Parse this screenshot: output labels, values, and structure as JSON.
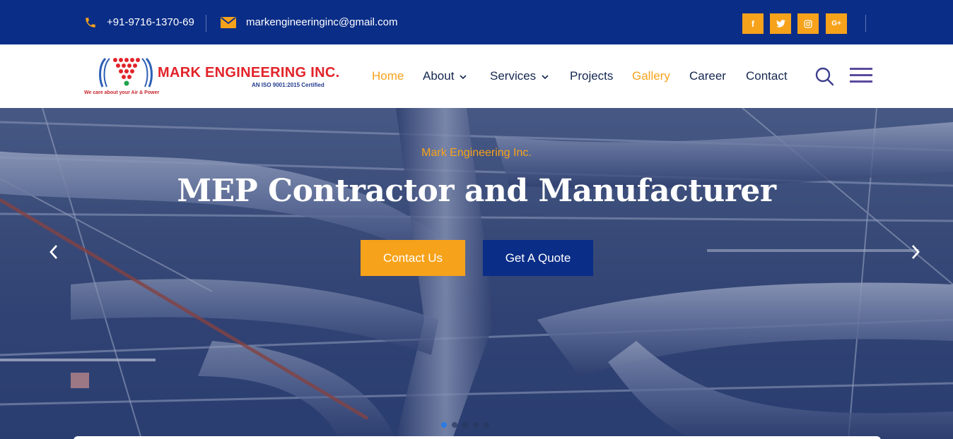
{
  "topbar": {
    "phone": "+91-9716-1370-69",
    "phone_icon": "phone-icon",
    "email": "markengineeringinc@gmail.com",
    "email_icon": "mail-icon",
    "social": [
      {
        "icon": "facebook-icon",
        "glyph": "f"
      },
      {
        "icon": "twitter-icon",
        "glyph": ""
      },
      {
        "icon": "instagram-icon",
        "glyph": ""
      },
      {
        "icon": "google-plus-icon",
        "glyph": "G+"
      }
    ]
  },
  "header": {
    "logo": {
      "brand": "MARK ENGINEERING INC.",
      "certification": "AN ISO 9001:2015 Certified",
      "tagline": "We care about your Air & Power"
    },
    "nav": [
      {
        "label": "Home",
        "active": true,
        "dropdown": false
      },
      {
        "label": "About",
        "active": false,
        "dropdown": true
      },
      {
        "label": "Services",
        "active": false,
        "dropdown": true
      },
      {
        "label": "Projects",
        "active": false,
        "dropdown": false
      },
      {
        "label": "Gallery",
        "active": true,
        "dropdown": false
      },
      {
        "label": "Career",
        "active": false,
        "dropdown": false
      },
      {
        "label": "Contact",
        "active": false,
        "dropdown": false
      }
    ],
    "search_icon": "search-icon",
    "menu_icon": "hamburger-menu-icon"
  },
  "hero": {
    "subtitle": "Mark Engineering Inc.",
    "title": "MEP Contractor and Manufacturer",
    "primary_button": "Contact Us",
    "secondary_button": "Get A Quote",
    "slide_count": 5,
    "active_slide": 1
  },
  "colors": {
    "topbar": "#0a2d87",
    "accent": "#f7a21b",
    "nav_text": "#15274f",
    "brand_red": "#e2232a"
  }
}
